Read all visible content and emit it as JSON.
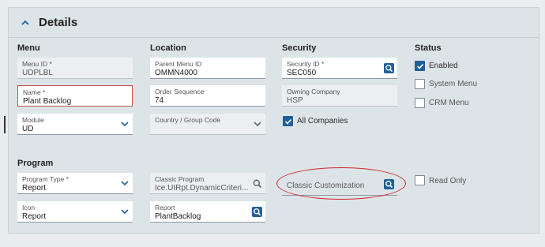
{
  "panel": {
    "title": "Details"
  },
  "columns": {
    "menu": "Menu",
    "location": "Location",
    "security": "Security",
    "status": "Status",
    "program": "Program"
  },
  "fields": {
    "menu_id": {
      "label": "Menu ID *",
      "value": "UDPLBL"
    },
    "name": {
      "label": "Name *",
      "value": "Plant Backlog"
    },
    "module": {
      "label": "Module",
      "value": "UD"
    },
    "parent_menu_id": {
      "label": "Parent Menu ID",
      "value": "OMMN4000"
    },
    "order_sequence": {
      "label": "Order Sequence",
      "value": "74"
    },
    "country_group_code": {
      "label": "Country / Group Code",
      "value": ""
    },
    "security_id": {
      "label": "Security ID *",
      "value": "SEC050"
    },
    "owning_company": {
      "label": "Owning Company",
      "value": "HSP"
    },
    "program_type": {
      "label": "Program Type *",
      "value": "Report"
    },
    "icon": {
      "label": "Icon",
      "value": "Report"
    },
    "classic_program": {
      "label": "Classic Program",
      "value": "Ice.UIRpt.DynamicCriteri..."
    },
    "report": {
      "label": "Report",
      "value": "PlantBacklog"
    },
    "classic_customization": {
      "label": "",
      "value": "Classic Customization"
    }
  },
  "checkboxes": {
    "all_companies": {
      "label": "All Companies",
      "checked": true
    },
    "enabled": {
      "label": "Enabled",
      "checked": true
    },
    "system_menu": {
      "label": "System Menu",
      "checked": false
    },
    "crm_menu": {
      "label": "CRM Menu",
      "checked": false
    },
    "read_only": {
      "label": "Read Only",
      "checked": false
    }
  },
  "icons": {
    "collapse": "chevron-up-icon",
    "dropdown": "chevron-down-icon",
    "lookup": "search-icon",
    "check": "check-icon"
  },
  "colors": {
    "accent": "#1f5f9a",
    "highlight_oval": "#cc2a2a",
    "error_border": "#c4504e"
  }
}
